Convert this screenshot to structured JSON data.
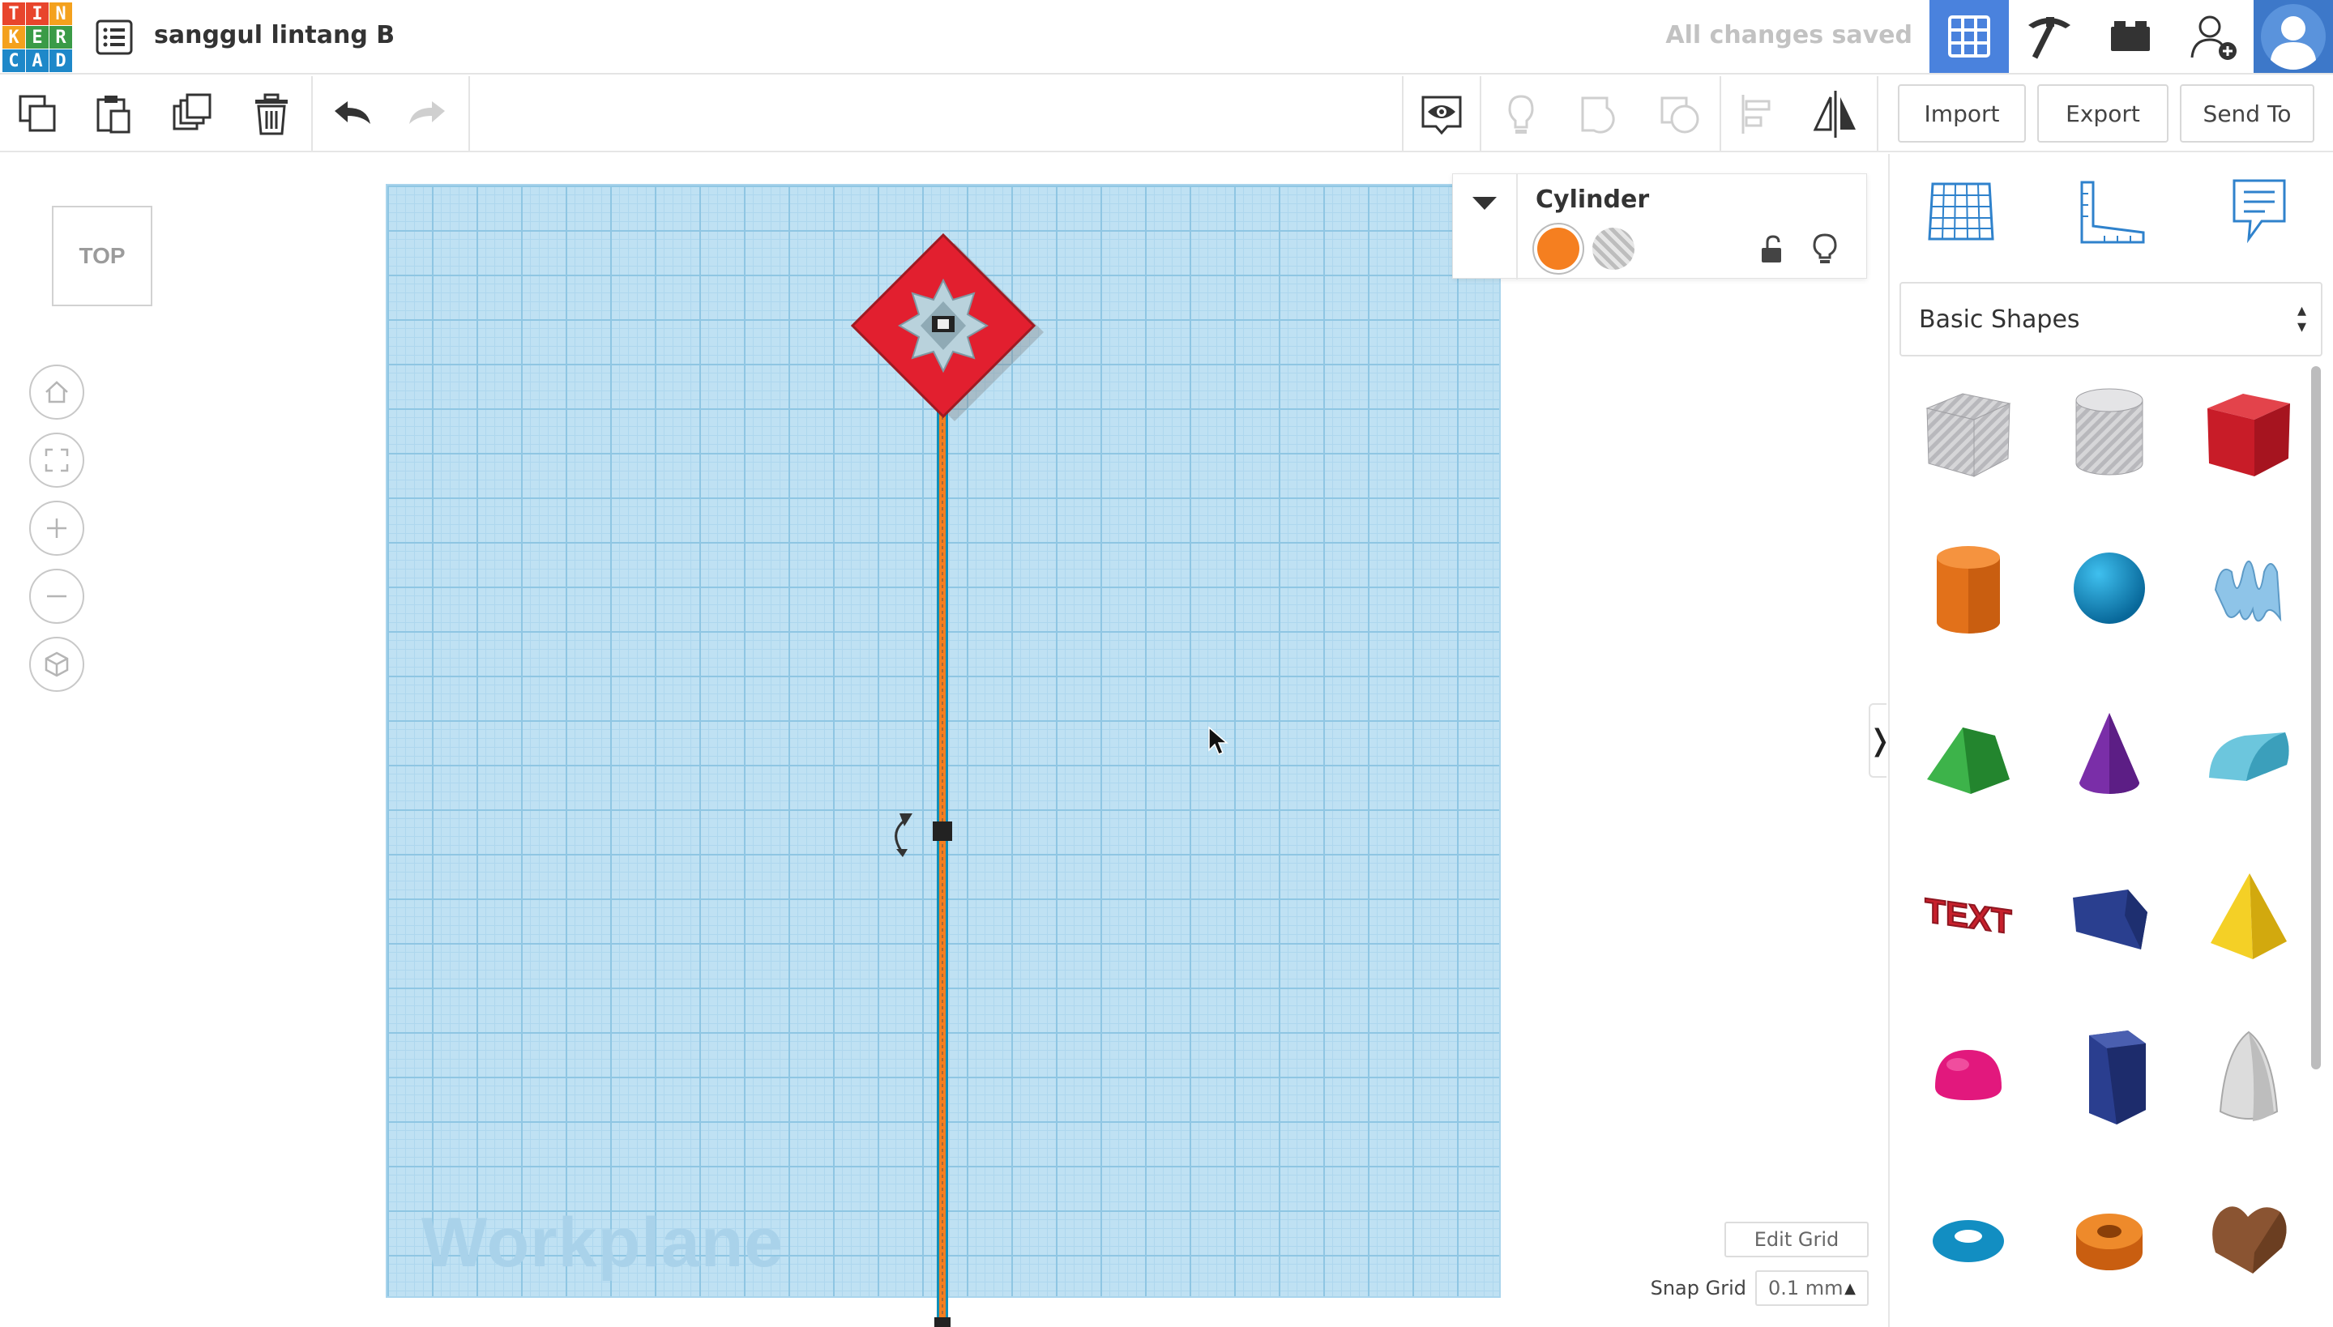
{
  "app": {
    "logo_letters": [
      "T",
      "I",
      "N",
      "K",
      "E",
      "R",
      "C",
      "A",
      "D"
    ],
    "logo_colors": [
      "#e8452c",
      "#e8452c",
      "#f4a11d",
      "#f4a11d",
      "#3a9b47",
      "#3a9b47",
      "#1e88c9",
      "#1e88c9",
      "#1e88c9"
    ],
    "design_title": "sanggul lintang B",
    "save_status": "All changes saved",
    "accent_color": "#4a82dd"
  },
  "header": {
    "view_buttons": [
      "3d-design-grid-icon",
      "codeblocks-pickaxe-icon",
      "bricks-icon"
    ],
    "invite_icon": "add-user-icon",
    "avatar_icon": "user-avatar-icon"
  },
  "toolbar": {
    "left_tools": [
      "copy-icon",
      "paste-icon",
      "duplicate-icon",
      "delete-icon",
      "undo-icon",
      "redo-icon"
    ],
    "right_tools": [
      "view-toggle-icon",
      "show-all-icon",
      "group-icon",
      "ungroup-icon",
      "align-icon",
      "mirror-icon"
    ],
    "import_label": "Import",
    "export_label": "Export",
    "send_to_label": "Send To"
  },
  "canvas": {
    "viewcube_label": "TOP",
    "nav_buttons": [
      "home-view-icon",
      "fit-all-icon",
      "zoom-in-icon",
      "zoom-out-icon",
      "ortho-view-icon"
    ],
    "workplane_label": "Workplane",
    "edit_grid_label": "Edit Grid",
    "snap_grid_label": "Snap Grid",
    "snap_grid_value": "0.1 mm"
  },
  "inspector": {
    "shape_name": "Cylinder",
    "solid_color": "#f57f20",
    "modes": [
      "solid",
      "hole"
    ]
  },
  "shapes_panel": {
    "tabs": [
      "workplane-grid-icon",
      "ruler-icon",
      "notes-icon"
    ],
    "library": "Basic Shapes",
    "shapes": [
      "Box Hole",
      "Cylinder Hole",
      "Box",
      "Cylinder",
      "Sphere",
      "Scribble",
      "Roof",
      "Cone",
      "Round Roof",
      "Text",
      "Wedge",
      "Pyramid",
      "Half Sphere",
      "Polygon",
      "Paraboloid",
      "Torus",
      "Tube",
      "Heart"
    ],
    "text_shape_label": "TEXT"
  }
}
